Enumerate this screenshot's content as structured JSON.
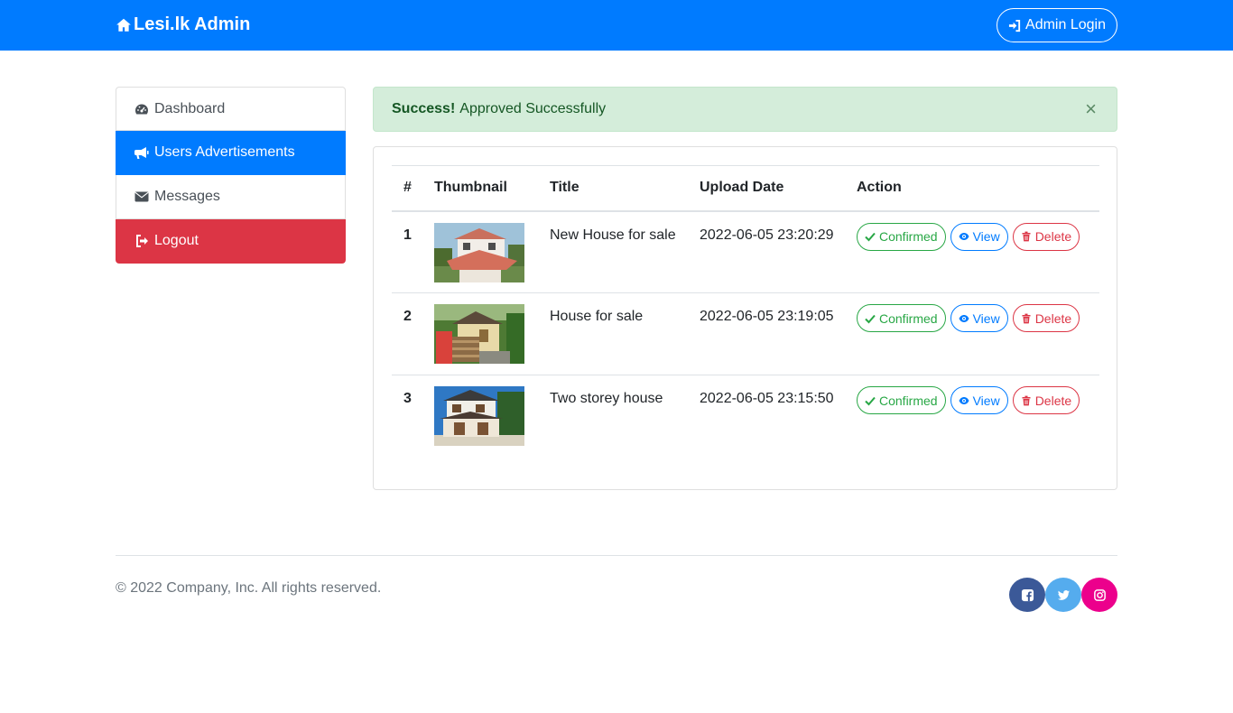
{
  "navbar": {
    "brand": "Lesi.lk Admin",
    "login_label": "Admin Login",
    "bg_color": "#007bff"
  },
  "sidebar": {
    "items": [
      {
        "label": "Dashboard",
        "icon": "dashboard-icon"
      },
      {
        "label": "Users Advertisements",
        "icon": "megaphone-icon",
        "active": true
      },
      {
        "label": "Messages",
        "icon": "envelope-icon"
      },
      {
        "label": "Logout",
        "icon": "logout-icon",
        "color": "#dc3545"
      }
    ]
  },
  "alert": {
    "strong": "Success!",
    "message": "Approved Successfully",
    "close": "×"
  },
  "table": {
    "headers": [
      "#",
      "Thumbnail",
      "Title",
      "Upload Date",
      "Action"
    ],
    "rows": [
      {
        "num": "1",
        "title": "New House for sale",
        "date": "2022-06-05 23:20:29"
      },
      {
        "num": "2",
        "title": "House for sale",
        "date": "2022-06-05 23:19:05"
      },
      {
        "num": "3",
        "title": "Two storey house",
        "date": "2022-06-05 23:15:50"
      }
    ],
    "actions": {
      "confirmed": "Confirmed",
      "view": "View",
      "delete": "Delete"
    }
  },
  "footer": {
    "copyright": "© 2022 Company, Inc. All rights reserved.",
    "social": [
      {
        "icon": "facebook-icon",
        "color": "#3b5998"
      },
      {
        "icon": "twitter-icon",
        "color": "#55acee"
      },
      {
        "icon": "instagram-icon",
        "color": "#ec008c"
      }
    ]
  }
}
